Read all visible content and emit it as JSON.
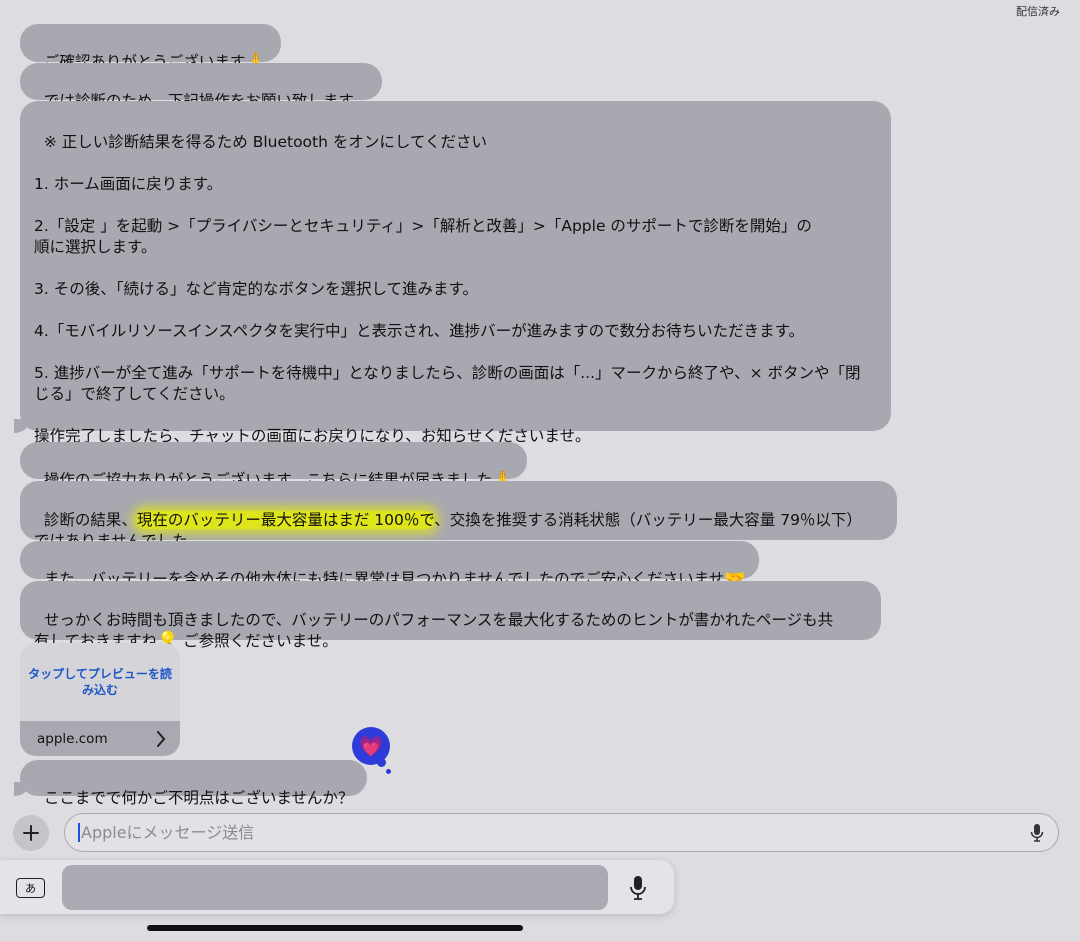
{
  "status": {
    "delivered": "配信済み"
  },
  "messages": [
    {
      "text": "ご確認ありがとうございます",
      "emoji": "🙏"
    },
    {
      "text": "では診断のため、下記操作をお願い致します。"
    },
    {
      "text": "※ 正しい診断結果を得るため Bluetooth をオンにしてください\n\n1. ホーム画面に戻ります。\n\n2.「設定 」を起動 >「プライバシーとセキュリティ」>「解析と改善」>「Apple のサポートで診断を開始」の\n順に選択します。\n\n3. その後、「続ける」など肯定的なボタンを選択して進みます。\n\n4.「モバイルリソースインスペクタを実行中」と表示され、進捗バーが進みますので数分お待ちいただきます。\n\n5. 進捗バーが全て進み「サポートを待機中」となりましたら、診断の画面は「...」マークから終了や、× ボタンや「閉\nじる」で終了してください。\n\n操作完了しましたら、チャットの画面にお戻りになり、お知らせくださいませ。"
    },
    {
      "text": "操作のご協力ありがとうございます、こちらに結果が届きました",
      "emoji": "🙏"
    },
    {
      "pre": "診断の結果、",
      "highlight": "現在のバッテリー最大容量はまだ 100％で",
      "post": "、交換を推奨する消耗状態（バッテリー最大容量 79％以下）\nではありませんでした。"
    },
    {
      "text": "また、バッテリーを含めその他本体にも特に異常は見つかりませんでしたのでご安心くださいませ",
      "emoji": "🤝"
    },
    {
      "text": "せっかくお時間も頂きましたので、バッテリーのパフォーマンスを最大化するためのヒントが書かれたページも共\n有しておきますね",
      "emoji": "💡",
      "post": " ご参照くださいませ。"
    },
    {
      "text": "ここまでで何かご不明点はございませんか？"
    }
  ],
  "link_card": {
    "preview_text": "タップしてプレビューを読み込む",
    "domain": "apple.com",
    "chevron": "›"
  },
  "tapback": {
    "icon": "heart-icon",
    "glyph": "💗"
  },
  "composer": {
    "plus": "+",
    "placeholder": "Appleにメッセージ送信",
    "value": ""
  },
  "keyboard": {
    "kana_key": "あ"
  },
  "colors": {
    "bubble": "#a8a8b0",
    "highlight": "#e8f000",
    "tapback": "#2d3bd8",
    "link": "#1f56c9"
  }
}
